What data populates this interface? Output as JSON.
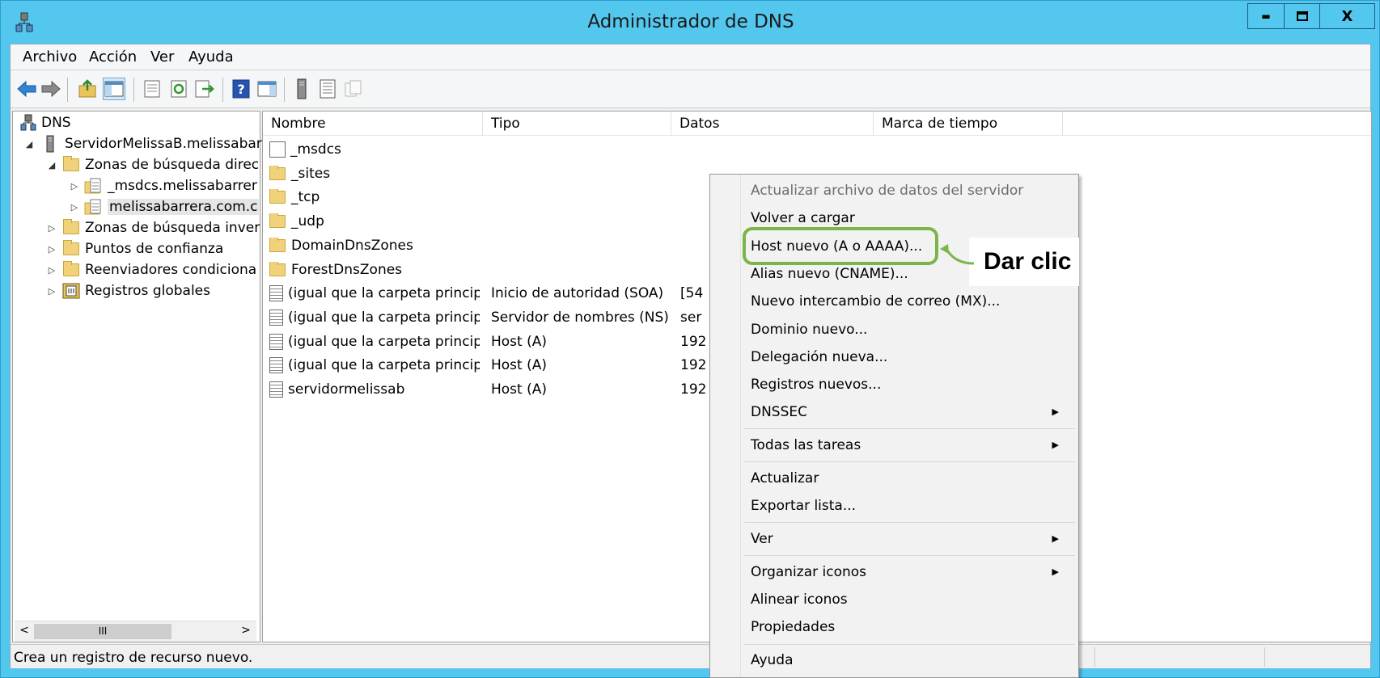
{
  "window": {
    "title": "Administrador de DNS",
    "minimize": "▬",
    "maximize": "☐",
    "close": "X"
  },
  "menubar": [
    "Archivo",
    "Acción",
    "Ver",
    "Ayuda"
  ],
  "tree": {
    "root": "DNS",
    "server": "ServidorMelissaB.melissabar",
    "forward_zones": "Zonas de búsqueda direc",
    "zone_msdcs": "_msdcs.melissabarrer",
    "zone_main": "melissabarrera.com.c",
    "reverse_zones": "Zonas de búsqueda inver",
    "trust_points": "Puntos de confianza",
    "conditional_forwarders": "Reenviadores condiciona",
    "global_logs": "Registros globales",
    "scroll_thumb": "III"
  },
  "list": {
    "columns": [
      "Nombre",
      "Tipo",
      "Datos",
      "Marca de tiempo"
    ],
    "rows": [
      {
        "name": "_msdcs",
        "type": "",
        "data": "",
        "icon": "zone"
      },
      {
        "name": "_sites",
        "type": "",
        "data": "",
        "icon": "folder"
      },
      {
        "name": "_tcp",
        "type": "",
        "data": "",
        "icon": "folder"
      },
      {
        "name": "_udp",
        "type": "",
        "data": "",
        "icon": "folder"
      },
      {
        "name": "DomainDnsZones",
        "type": "",
        "data": "",
        "icon": "folder"
      },
      {
        "name": "ForestDnsZones",
        "type": "",
        "data": "",
        "icon": "folder"
      },
      {
        "name": "(igual que la carpeta princip...",
        "type": "Inicio de autoridad (SOA)",
        "data": "[54",
        "icon": "record"
      },
      {
        "name": "(igual que la carpeta princip...",
        "type": "Servidor de nombres (NS)",
        "data": "ser",
        "icon": "record"
      },
      {
        "name": "(igual que la carpeta princip...",
        "type": "Host (A)",
        "data": "192",
        "icon": "record"
      },
      {
        "name": "(igual que la carpeta princip...",
        "type": "Host (A)",
        "data": "192",
        "icon": "record"
      },
      {
        "name": "servidormelissab",
        "type": "Host (A)",
        "data": "192",
        "icon": "record"
      }
    ]
  },
  "context_menu": {
    "items": [
      "Actualizar archivo de datos del servidor",
      "Volver a cargar",
      "Host nuevo (A o AAAA)...",
      "Alias nuevo (CNAME)...",
      "Nuevo intercambio de correo (MX)...",
      "Dominio nuevo...",
      "Delegación nueva...",
      "Registros nuevos...",
      "DNSSEC",
      "Todas las tareas",
      "Actualizar",
      "Exportar lista...",
      "Ver",
      "Organizar iconos",
      "Alinear iconos",
      "Propiedades",
      "Ayuda"
    ],
    "submenu_arrow": "▶"
  },
  "statusbar": {
    "text": "Crea un registro de recurso nuevo."
  },
  "annotation": {
    "label": "Dar clic",
    "color": "#7ab648"
  }
}
